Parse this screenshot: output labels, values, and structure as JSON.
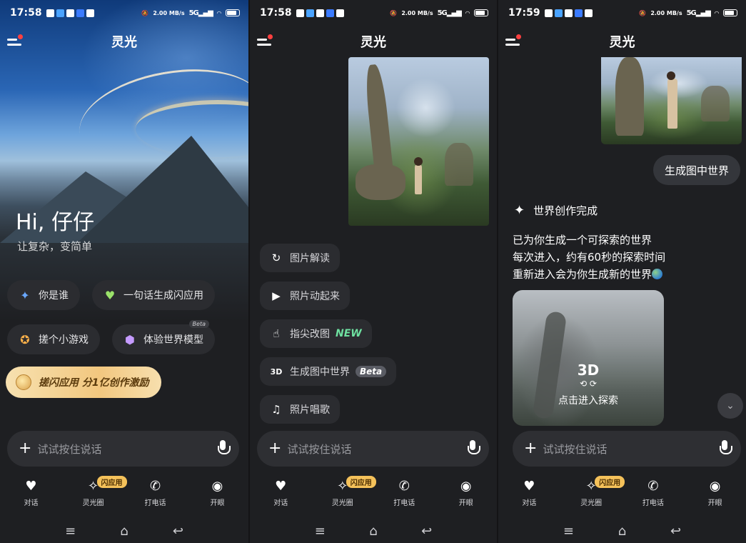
{
  "status": [
    {
      "time": "17:58",
      "net": "2.00 MB/s",
      "gen": "5G"
    },
    {
      "time": "17:58",
      "net": "2.00 MB/s",
      "gen": "5G"
    },
    {
      "time": "17:59",
      "net": "2.00 MB/s",
      "gen": "5G"
    }
  ],
  "app": {
    "title": "灵光"
  },
  "home": {
    "greeting": "Hi, 仔仔",
    "tagline": "让复杂，变简单",
    "chips": [
      "你是谁",
      "一句话生成闪应用",
      "搓个小游戏",
      "体验世界模型"
    ],
    "beta_label": "Beta",
    "promo": "搓闪应用 分1亿创作激励"
  },
  "tools": {
    "items": [
      "图片解读",
      "照片动起来",
      "指尖改图",
      "生成图中世界",
      "照片唱歌"
    ],
    "new_label": "NEW",
    "beta_label": "Beta"
  },
  "world": {
    "user_message": "生成图中世界",
    "done_title": "世界创作完成",
    "lines": [
      "已为你生成一个可探索的世界",
      "每次进入，约有60秒的探索时间",
      "重新进入会为你生成新的世界"
    ],
    "badge": "3D",
    "enter_label": "点击进入探索"
  },
  "input": {
    "placeholder": "试试按住说话"
  },
  "nav": {
    "items": [
      "对话",
      "灵光圈",
      "打电话",
      "开眼"
    ],
    "badge": "闪应用"
  },
  "colors": {
    "background": "#1e1f22",
    "chip": "#2b2c30",
    "accent_gold": "#f4c15a",
    "new_green": "#6ee0a0"
  }
}
